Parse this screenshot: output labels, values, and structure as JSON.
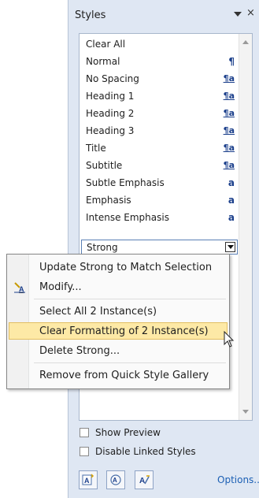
{
  "pane": {
    "title": "Styles",
    "close_glyph": "×",
    "styles": [
      {
        "label": "Clear All",
        "mark": ""
      },
      {
        "label": "Normal",
        "mark": "¶"
      },
      {
        "label": "No Spacing",
        "mark": "¶a"
      },
      {
        "label": "Heading 1",
        "mark": "¶a"
      },
      {
        "label": "Heading 2",
        "mark": "¶a"
      },
      {
        "label": "Heading 3",
        "mark": "¶a"
      },
      {
        "label": "Title",
        "mark": "¶a"
      },
      {
        "label": "Subtitle",
        "mark": "¶a"
      },
      {
        "label": "Subtle Emphasis",
        "mark": "a"
      },
      {
        "label": "Emphasis",
        "mark": "a"
      },
      {
        "label": "Intense Emphasis",
        "mark": "a"
      },
      {
        "label": "Strong",
        "mark": ""
      }
    ],
    "checkboxes": [
      {
        "label": "Show Preview",
        "checked": false
      },
      {
        "label": "Disable Linked Styles",
        "checked": false
      }
    ],
    "options_label": "Options..."
  },
  "context_menu": {
    "items": [
      {
        "label": "Update Strong to Match Selection"
      },
      {
        "label": "Modify..."
      },
      {
        "label": "Select All 2 Instance(s)"
      },
      {
        "label": "Clear Formatting of 2 Instance(s)"
      },
      {
        "label": "Delete Strong..."
      },
      {
        "label": "Remove from Quick Style Gallery"
      }
    ]
  }
}
